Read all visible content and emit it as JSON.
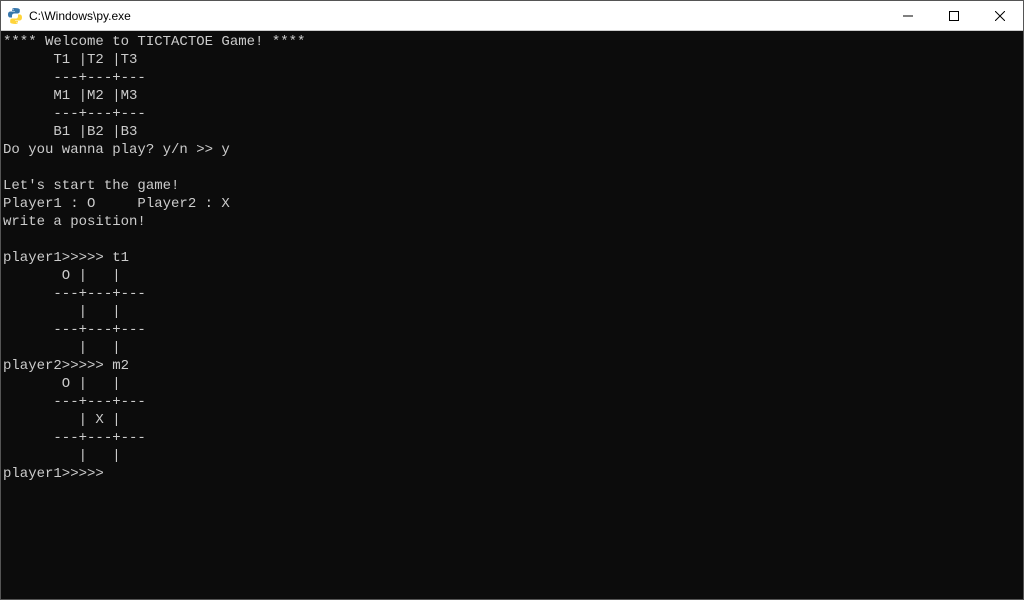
{
  "window": {
    "title": "C:\\Windows\\py.exe",
    "icon_name": "python-icon"
  },
  "terminal": {
    "lines": [
      "**** Welcome to TICTACTOE Game! ****",
      "      T1 |T2 |T3",
      "      ---+---+---",
      "      M1 |M2 |M3",
      "      ---+---+---",
      "      B1 |B2 |B3",
      "Do you wanna play? y/n >> y",
      "",
      "Let's start the game!",
      "Player1 : O     Player2 : X",
      "write a position!",
      "",
      "player1>>>>> t1",
      "       O |   |",
      "      ---+---+---",
      "         |   |",
      "      ---+---+---",
      "         |   |",
      "player2>>>>> m2",
      "       O |   |",
      "      ---+---+---",
      "         | X |",
      "      ---+---+---",
      "         |   |",
      "player1>>>>>"
    ]
  }
}
